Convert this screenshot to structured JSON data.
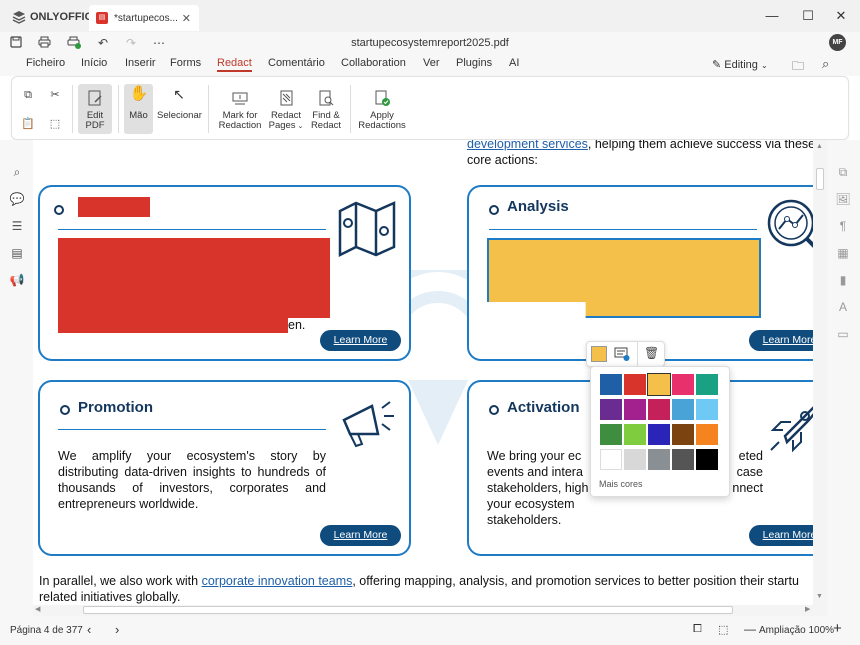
{
  "app": {
    "logo": "ONLYOFFICE",
    "tab_title": "*startupecos...",
    "doc_title": "startupecosystemreport2025.pdf",
    "avatar": "MF"
  },
  "menu": [
    "Ficheiro",
    "Início",
    "Inserir",
    "Forms",
    "Redact",
    "Comentário",
    "Collaboration",
    "Ver",
    "Plugins",
    "AI"
  ],
  "menu_active_index": 4,
  "editing_label": "Editing",
  "ribbon": {
    "edit_pdf": [
      "Edit",
      "PDF"
    ],
    "hand": "Mão",
    "select": "Selecionar",
    "mark": [
      "Mark for",
      "Redaction"
    ],
    "redact_pages": [
      "Redact",
      "Pages"
    ],
    "find_redact": [
      "Find &",
      "Redact"
    ],
    "apply": [
      "Apply",
      "Redactions"
    ]
  },
  "doc": {
    "top_right_line1": "development services, helping them achieve success via these",
    "top_right_line1_link": "development services",
    "top_right_line2": "core actions:",
    "card1": {
      "tail_text": "en.",
      "button": "Learn More"
    },
    "card2": {
      "title": "Analysis",
      "button": "Learn More"
    },
    "card3": {
      "title": "Promotion",
      "text": "We amplify your ecosystem's story by distributing data-driven insights to hundreds of thousands of investors, corporates and entrepreneurs worldwide.",
      "button": "Learn More"
    },
    "card4": {
      "title": "Activation",
      "lines": [
        "We bring your ec",
        "eted",
        "events and intera",
        "case",
        "stakeholders, high",
        "nnect",
        "your ecosystem stakeholders."
      ],
      "button": "Learn More"
    },
    "bottom_p1_pre": "In parallel, we also work with ",
    "bottom_p1_link": "corporate innovation teams",
    "bottom_p1_post": ", offering mapping, analysis, and promotion services to better position their startu",
    "bottom_p2": "related initiatives globally."
  },
  "palette": {
    "more_colors": "Mais cores",
    "colors": [
      "#1f5fa6",
      "#d9342b",
      "#f5c04a",
      "#e8306d",
      "#1aa083",
      "#6a2c91",
      "#a3208f",
      "#c4215a",
      "#4aa3d6",
      "#6ecaf5",
      "#3f8e3f",
      "#7fcc3f",
      "#2b24b8",
      "#7a4310",
      "#f5831f",
      "#ffffff",
      "#d8d8d8",
      "#8a8f93",
      "#555555",
      "#000000"
    ],
    "current": "#f5c04a"
  },
  "redactions": {
    "red": "#d9342b",
    "yellow": "#f5c04a"
  },
  "status": {
    "page": "Página 4 de 377",
    "zoom": "Ampliação 100%"
  }
}
